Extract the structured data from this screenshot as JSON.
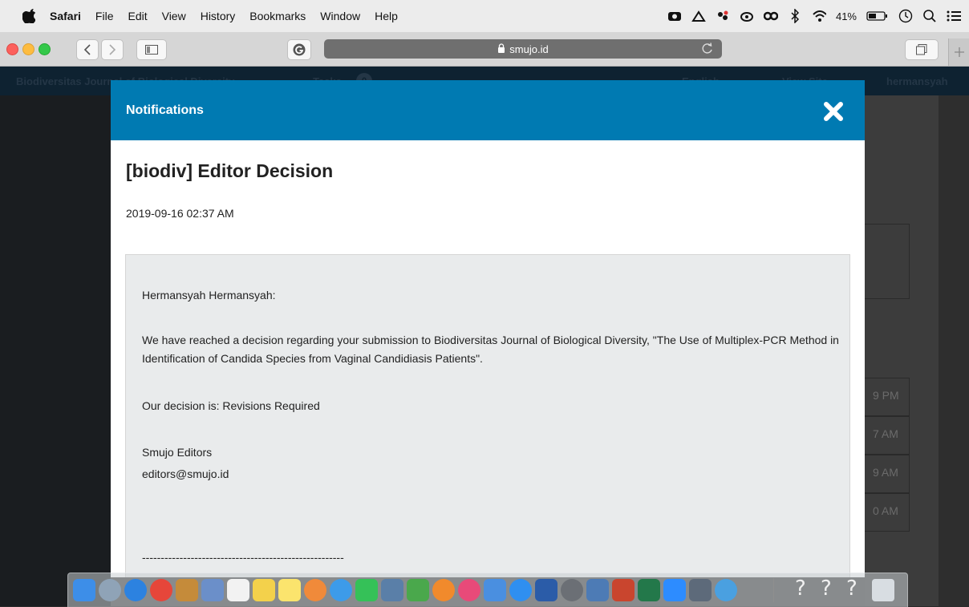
{
  "menubar": {
    "app": "Safari",
    "items": [
      "File",
      "Edit",
      "View",
      "History",
      "Bookmarks",
      "Window",
      "Help"
    ],
    "battery": "41%"
  },
  "browser": {
    "url": "smujo.id"
  },
  "background_page": {
    "journal": "Biodiversitas Journal of Biological Diversity",
    "tasks": "Tasks",
    "tasks_count": "0",
    "language": "English",
    "view_site": "View Site",
    "user": "hermansyah",
    "times": [
      "9 PM",
      "7 AM",
      "9 AM",
      "0 AM"
    ]
  },
  "modal": {
    "title": "Notifications",
    "subject": "[biodiv] Editor Decision",
    "date": "2019-09-16 02:37 AM",
    "body": {
      "greeting": "Hermansyah Hermansyah:",
      "paragraph": "We have reached a decision regarding your submission to Biodiversitas Journal of Biological Diversity, \"The Use of Multiplex-PCR Method in Identification of Candida Species from Vaginal Candidiasis Patients\".",
      "decision": "Our decision is: Revisions Required",
      "signature_name": "Smujo Editors",
      "signature_email": "editors@smujo.id",
      "separator": "------------------------------------------------------"
    }
  },
  "dock": {
    "unknown_labels": [
      "?",
      "?",
      "?"
    ]
  }
}
